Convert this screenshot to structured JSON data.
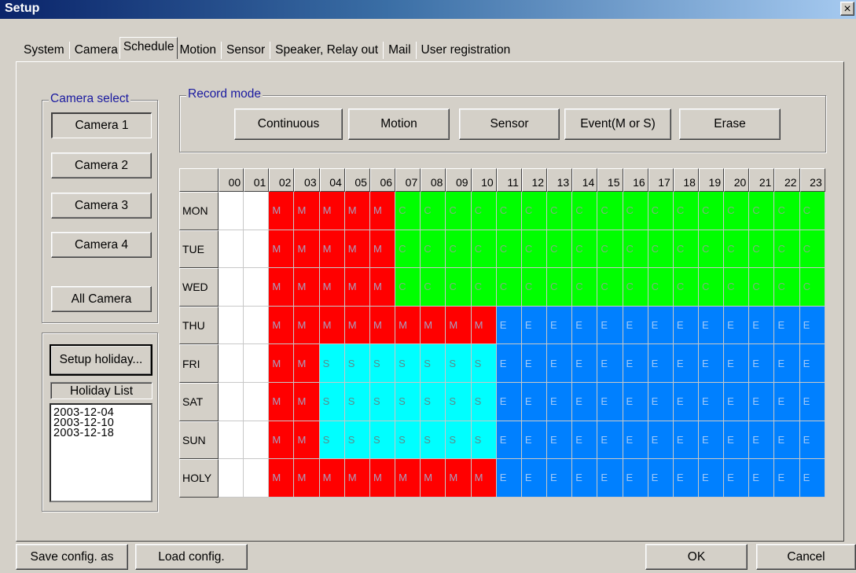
{
  "window": {
    "title": "Setup",
    "close_glyph": "×"
  },
  "tabs": [
    {
      "label": "System",
      "active": false
    },
    {
      "label": "Camera",
      "active": false
    },
    {
      "label": "Schedule",
      "active": true
    },
    {
      "label": "Motion",
      "active": false
    },
    {
      "label": "Sensor",
      "active": false
    },
    {
      "label": "Speaker, Relay out",
      "active": false
    },
    {
      "label": "Mail",
      "active": false
    },
    {
      "label": "User registration",
      "active": false
    }
  ],
  "camera_select": {
    "title": "Camera select",
    "buttons": [
      "Camera 1",
      "Camera 2",
      "Camera 3",
      "Camera 4"
    ],
    "all_button": "All Camera",
    "selected": "Camera 1"
  },
  "holiday": {
    "setup_button": "Setup holiday...",
    "list_label": "Holiday List",
    "dates": [
      "2003-12-04",
      "2003-12-10",
      "2003-12-18"
    ]
  },
  "record_mode": {
    "title": "Record mode",
    "buttons": [
      "Continuous",
      "Motion",
      "Sensor",
      "Event(M or S)",
      "Erase"
    ]
  },
  "schedule": {
    "hours": [
      "00",
      "01",
      "02",
      "03",
      "04",
      "05",
      "06",
      "07",
      "08",
      "09",
      "10",
      "11",
      "12",
      "13",
      "14",
      "15",
      "16",
      "17",
      "18",
      "19",
      "20",
      "21",
      "22",
      "23"
    ],
    "days": [
      {
        "label": "MON",
        "cells": [
          "",
          "",
          "M",
          "M",
          "M",
          "M",
          "M",
          "C",
          "C",
          "C",
          "C",
          "C",
          "C",
          "C",
          "C",
          "C",
          "C",
          "C",
          "C",
          "C",
          "C",
          "C",
          "C",
          "C"
        ]
      },
      {
        "label": "TUE",
        "cells": [
          "",
          "",
          "M",
          "M",
          "M",
          "M",
          "M",
          "C",
          "C",
          "C",
          "C",
          "C",
          "C",
          "C",
          "C",
          "C",
          "C",
          "C",
          "C",
          "C",
          "C",
          "C",
          "C",
          "C"
        ]
      },
      {
        "label": "WED",
        "cells": [
          "",
          "",
          "M",
          "M",
          "M",
          "M",
          "M",
          "C",
          "C",
          "C",
          "C",
          "C",
          "C",
          "C",
          "C",
          "C",
          "C",
          "C",
          "C",
          "C",
          "C",
          "C",
          "C",
          "C"
        ]
      },
      {
        "label": "THU",
        "cells": [
          "",
          "",
          "M",
          "M",
          "M",
          "M",
          "M",
          "M",
          "M",
          "M",
          "M",
          "E",
          "E",
          "E",
          "E",
          "E",
          "E",
          "E",
          "E",
          "E",
          "E",
          "E",
          "E",
          "E"
        ]
      },
      {
        "label": "FRI",
        "cells": [
          "",
          "",
          "M",
          "M",
          "S",
          "S",
          "S",
          "S",
          "S",
          "S",
          "S",
          "E",
          "E",
          "E",
          "E",
          "E",
          "E",
          "E",
          "E",
          "E",
          "E",
          "E",
          "E",
          "E"
        ]
      },
      {
        "label": "SAT",
        "cells": [
          "",
          "",
          "M",
          "M",
          "S",
          "S",
          "S",
          "S",
          "S",
          "S",
          "S",
          "E",
          "E",
          "E",
          "E",
          "E",
          "E",
          "E",
          "E",
          "E",
          "E",
          "E",
          "E",
          "E"
        ]
      },
      {
        "label": "SUN",
        "cells": [
          "",
          "",
          "M",
          "M",
          "S",
          "S",
          "S",
          "S",
          "S",
          "S",
          "S",
          "E",
          "E",
          "E",
          "E",
          "E",
          "E",
          "E",
          "E",
          "E",
          "E",
          "E",
          "E",
          "E"
        ]
      },
      {
        "label": "HOLY",
        "cells": [
          "",
          "",
          "M",
          "M",
          "M",
          "M",
          "M",
          "M",
          "M",
          "M",
          "M",
          "E",
          "E",
          "E",
          "E",
          "E",
          "E",
          "E",
          "E",
          "E",
          "E",
          "E",
          "E",
          "E"
        ]
      }
    ],
    "colors": {
      "M": "#ff0000",
      "C": "#00ff00",
      "E": "#0080ff",
      "S": "#00ffff",
      "none": "#ffffff"
    }
  },
  "footer": {
    "save_button": "Save config. as",
    "load_button": "Load config.",
    "ok_button": "OK",
    "cancel_button": "Cancel"
  }
}
